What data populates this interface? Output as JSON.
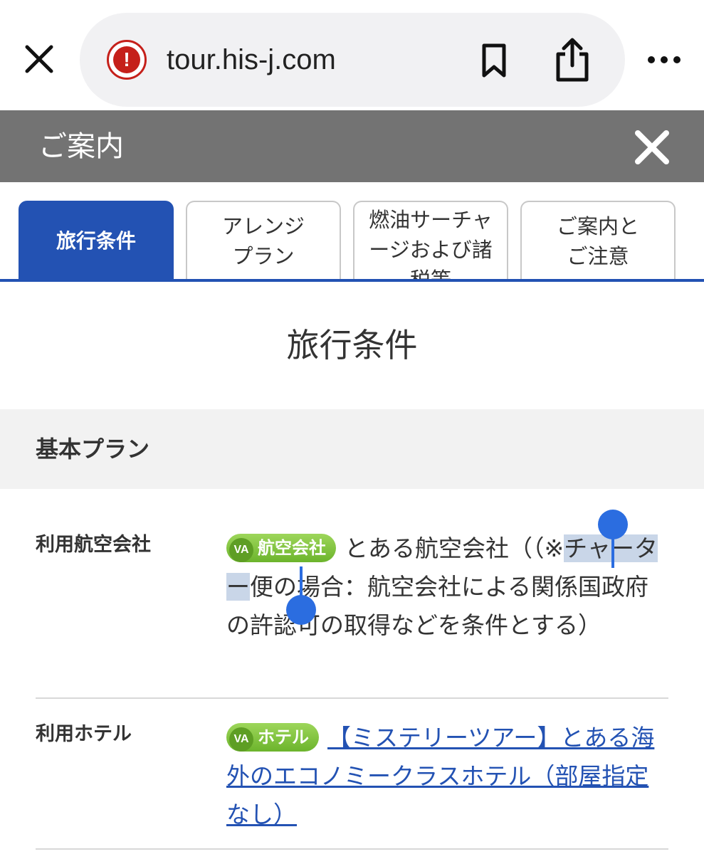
{
  "browser": {
    "url": "tour.his-j.com",
    "warning_icon_glyph": "!",
    "colors": {
      "warning": "#c5201a",
      "bar_bg": "#f1f1f3"
    }
  },
  "modal": {
    "title": "ご案内",
    "header_color": "#737373"
  },
  "tabs": [
    {
      "label": "旅行条件",
      "active": true
    },
    {
      "label": "アレンジ\nプラン",
      "active": false
    },
    {
      "label": "燃油サーチャ\nージおよび諸\n税等",
      "active": false
    },
    {
      "label": "ご案内と\nご注意",
      "active": false
    }
  ],
  "accent_color": "#2352b3",
  "content": {
    "section_title": "旅行条件",
    "subheader": "基本プラン",
    "rows": [
      {
        "label": "利用航空会社",
        "badge_prefix": "VA",
        "badge_text": "航空会社",
        "text_before": "とある航空会社（（※",
        "text_selected_1": "チャ",
        "text_selected_2": "ーター",
        "text_after": "便の場合：航空会社による関係国政府の許認可の取得などを条件とする）"
      },
      {
        "label": "利用ホテル",
        "badge_prefix": "VA",
        "badge_text": "ホテル",
        "link_text": "【ミステリーツアー】とある海外のエコノミークラスホテル（部屋指定なし）"
      }
    ]
  }
}
